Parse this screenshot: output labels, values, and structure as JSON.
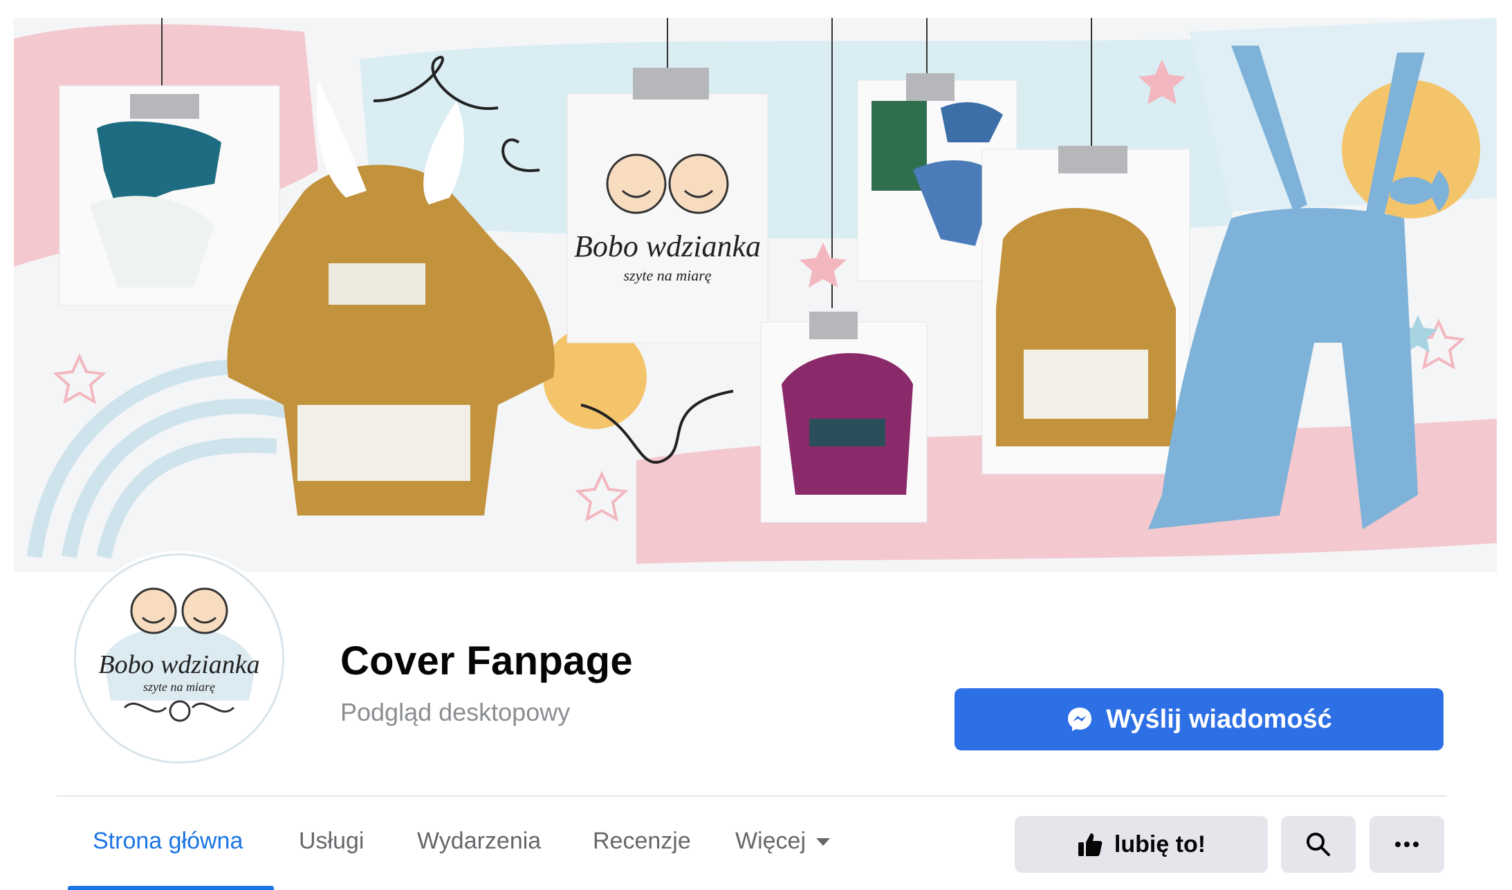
{
  "header": {
    "page_name": "Cover Fanpage",
    "subtitle": "Podgląd desktopowy"
  },
  "cover": {
    "logo_brand": "Bobo wdzianka",
    "logo_tagline": "szyte na miarę"
  },
  "actions": {
    "message_label": "Wyślij wiadomość",
    "like_label": "lubię to!",
    "search_icon": "search-icon",
    "more_icon": "more-dots-icon"
  },
  "tabs": [
    {
      "label": "Strona główna",
      "active": true
    },
    {
      "label": "Usługi"
    },
    {
      "label": "Wydarzenia"
    },
    {
      "label": "Recenzje"
    },
    {
      "label": "Więcej"
    }
  ],
  "colors": {
    "accent": "#1b74e4",
    "message_button": "#2d6fe4",
    "secondary_button": "#e4e6eb"
  }
}
